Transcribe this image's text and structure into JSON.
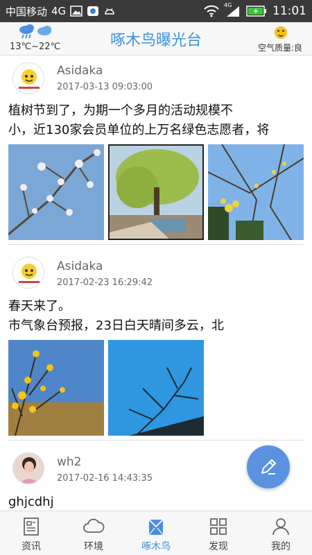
{
  "statusbar": {
    "carrier": "中国移动",
    "network": "4G",
    "signal_badge": "4G",
    "time": "11:01"
  },
  "header": {
    "title": "啄木鸟曝光台",
    "weather_icon": "cloud-rain-icon",
    "temperature": "13℃~22℃",
    "air_quality": "空气质量:良",
    "air_quality_icon": "smiley-icon"
  },
  "posts": [
    {
      "username": "Asidaka",
      "time": "2017-03-13 09:03:00",
      "text": "植树节到了，为期一个多月的活动规模不\n小，近130家会员单位的上万名绿色志愿者，将",
      "photos": [
        "blossom-branch-photo",
        "willow-lake-photo",
        "yellow-blossom-photo"
      ]
    },
    {
      "username": "Asidaka",
      "time": "2017-02-23 16:29:42",
      "text": "春天来了。\n市气象台预报，23日白天晴间多云，北",
      "photos": [
        "winter-jasmine-photo",
        "bare-tree-sky-photo"
      ]
    },
    {
      "username": "wh2",
      "time": "2017-02-16 14:43:35",
      "text": "ghjcdhj",
      "photos": []
    }
  ],
  "fab_icon": "pencil-icon",
  "bottom_nav": [
    {
      "label": "资讯",
      "icon": "news-icon",
      "active": false
    },
    {
      "label": "环境",
      "icon": "cloud-icon",
      "active": false
    },
    {
      "label": "啄木鸟",
      "icon": "woodpecker-icon",
      "active": true
    },
    {
      "label": "发现",
      "icon": "grid-icon",
      "active": false
    },
    {
      "label": "我的",
      "icon": "person-icon",
      "active": false
    }
  ],
  "colors": {
    "accent": "#3f93e0",
    "fab": "#5a92e0",
    "statusbar": "#3a3a3a"
  }
}
